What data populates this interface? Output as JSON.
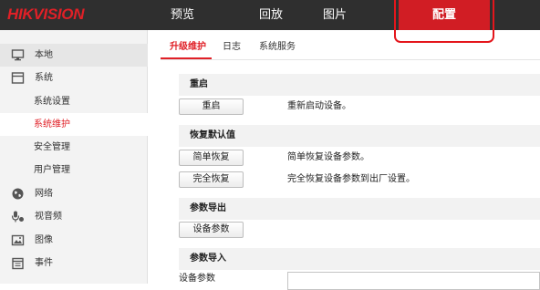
{
  "brand": {
    "logo_text": "HIKVISION"
  },
  "top_nav": {
    "items": [
      {
        "label": "预览"
      },
      {
        "label": "回放"
      },
      {
        "label": "图片"
      },
      {
        "label": "配置"
      }
    ],
    "active": "配置"
  },
  "sidebar": {
    "items": [
      {
        "label": "本地",
        "icon": "monitor-icon"
      },
      {
        "label": "系统",
        "icon": "system-window-icon"
      },
      {
        "label": "系统设置"
      },
      {
        "label": "系统维护"
      },
      {
        "label": "安全管理"
      },
      {
        "label": "用户管理"
      },
      {
        "label": "网络",
        "icon": "globe-icon"
      },
      {
        "label": "视音频",
        "icon": "microphone-icon"
      },
      {
        "label": "图像",
        "icon": "image-icon"
      },
      {
        "label": "事件",
        "icon": "calendar-icon"
      }
    ],
    "selected": "系统维护"
  },
  "tabs": {
    "items": [
      {
        "label": "升级维护"
      },
      {
        "label": "日志"
      },
      {
        "label": "系统服务"
      }
    ],
    "active": "升级维护"
  },
  "sections": {
    "reboot": {
      "title": "重启",
      "button": "重启",
      "description": "重新启动设备。"
    },
    "restore": {
      "title": "恢复默认值",
      "simple_button": "简单恢复",
      "simple_description": "简单恢复设备参数。",
      "full_button": "完全恢复",
      "full_description": "完全恢复设备参数到出厂设置。"
    },
    "export": {
      "title": "参数导出",
      "button": "设备参数"
    },
    "import": {
      "title": "参数导入",
      "field_label": "设备参数",
      "field_value": ""
    }
  },
  "colors": {
    "accent": "#e02027",
    "topbar": "#2f2f2f",
    "active_nav": "#d11d24",
    "annotation_box": "#e4161c"
  }
}
